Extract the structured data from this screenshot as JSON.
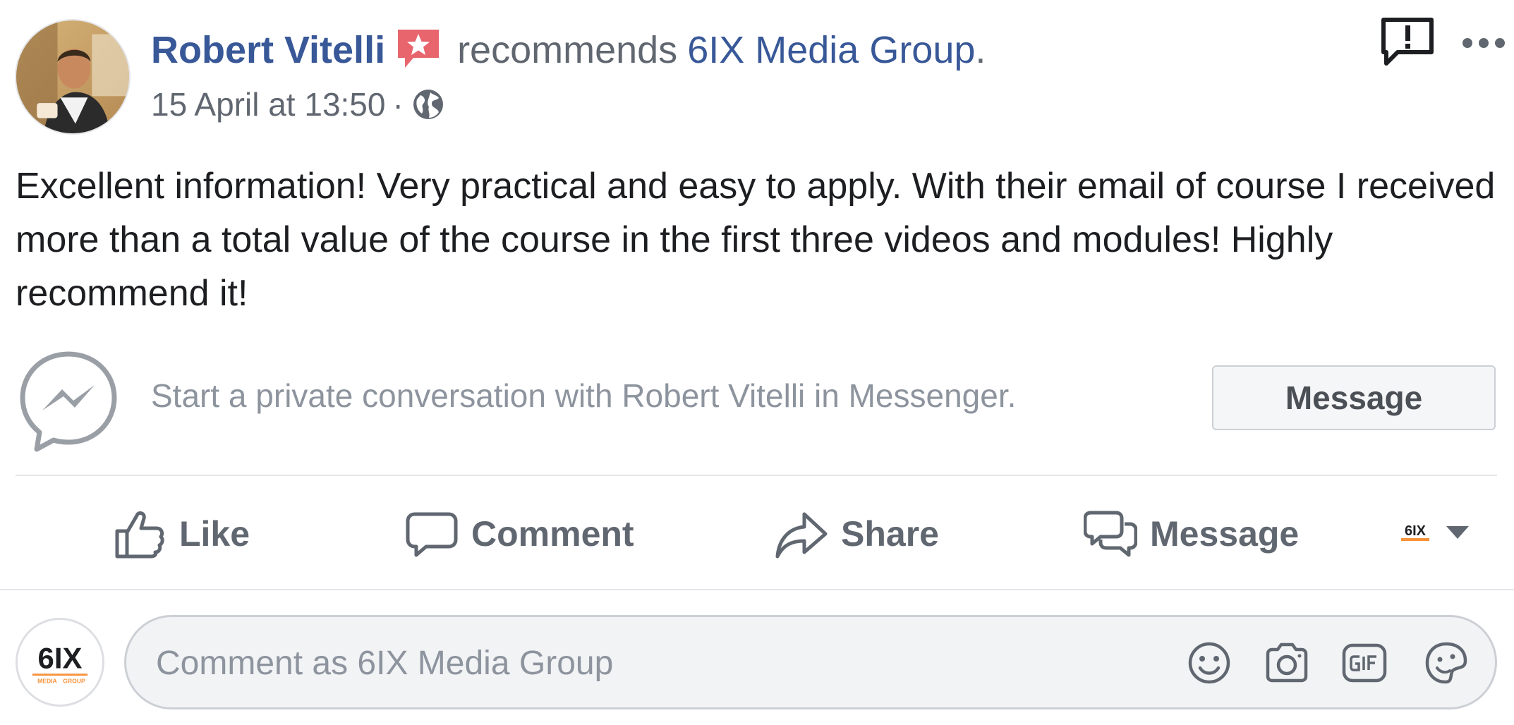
{
  "post": {
    "author": "Robert Vitelli",
    "verb": "recommends",
    "page_name": "6IX Media Group",
    "period": ".",
    "timestamp": "15 April at 13:50",
    "meta_separator": "·",
    "text": "Excellent information! Very practical and easy to apply. With their email of course I received more than a total value of the course in the first three videos and modules! Highly recommend it!"
  },
  "messenger": {
    "prompt": "Start a private conversation with Robert Vitelli in Messenger.",
    "button_label": "Message"
  },
  "actions": {
    "like": "Like",
    "comment": "Comment",
    "share": "Share",
    "message": "Message"
  },
  "composer": {
    "placeholder": "Comment as 6IX Media Group",
    "value": ""
  },
  "page_logo": {
    "main": "6IX",
    "sub_left": "MEDIA",
    "sub_right": "GROUP"
  },
  "icons": {
    "badge": "recommendation-star-icon",
    "audience": "globe-icon",
    "report": "report-exclamation-icon",
    "more": "more-options-icon",
    "messenger": "messenger-icon",
    "like": "thumbs-up-icon",
    "comment": "comment-bubble-icon",
    "share": "share-arrow-icon",
    "message": "message-bubbles-icon",
    "switcher": "chevron-down-icon",
    "emoji": "emoji-icon",
    "camera": "camera-icon",
    "gif": "gif-icon",
    "sticker": "sticker-icon"
  },
  "colors": {
    "link_blue": "#385898",
    "badge_red": "#e8656d",
    "secondary_text": "#616770",
    "logo_orange": "#f7923a"
  }
}
